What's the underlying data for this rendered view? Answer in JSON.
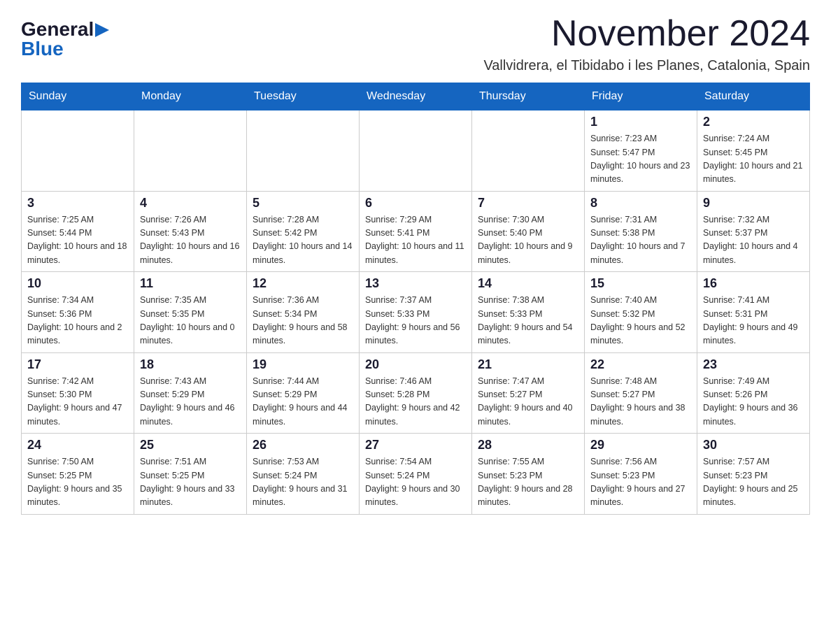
{
  "logo": {
    "general": "General",
    "blue": "Blue"
  },
  "title": "November 2024",
  "location": "Vallvidrera, el Tibidabo i les Planes, Catalonia, Spain",
  "days_of_week": [
    "Sunday",
    "Monday",
    "Tuesday",
    "Wednesday",
    "Thursday",
    "Friday",
    "Saturday"
  ],
  "weeks": [
    [
      {
        "day": "",
        "info": ""
      },
      {
        "day": "",
        "info": ""
      },
      {
        "day": "",
        "info": ""
      },
      {
        "day": "",
        "info": ""
      },
      {
        "day": "",
        "info": ""
      },
      {
        "day": "1",
        "info": "Sunrise: 7:23 AM\nSunset: 5:47 PM\nDaylight: 10 hours and 23 minutes."
      },
      {
        "day": "2",
        "info": "Sunrise: 7:24 AM\nSunset: 5:45 PM\nDaylight: 10 hours and 21 minutes."
      }
    ],
    [
      {
        "day": "3",
        "info": "Sunrise: 7:25 AM\nSunset: 5:44 PM\nDaylight: 10 hours and 18 minutes."
      },
      {
        "day": "4",
        "info": "Sunrise: 7:26 AM\nSunset: 5:43 PM\nDaylight: 10 hours and 16 minutes."
      },
      {
        "day": "5",
        "info": "Sunrise: 7:28 AM\nSunset: 5:42 PM\nDaylight: 10 hours and 14 minutes."
      },
      {
        "day": "6",
        "info": "Sunrise: 7:29 AM\nSunset: 5:41 PM\nDaylight: 10 hours and 11 minutes."
      },
      {
        "day": "7",
        "info": "Sunrise: 7:30 AM\nSunset: 5:40 PM\nDaylight: 10 hours and 9 minutes."
      },
      {
        "day": "8",
        "info": "Sunrise: 7:31 AM\nSunset: 5:38 PM\nDaylight: 10 hours and 7 minutes."
      },
      {
        "day": "9",
        "info": "Sunrise: 7:32 AM\nSunset: 5:37 PM\nDaylight: 10 hours and 4 minutes."
      }
    ],
    [
      {
        "day": "10",
        "info": "Sunrise: 7:34 AM\nSunset: 5:36 PM\nDaylight: 10 hours and 2 minutes."
      },
      {
        "day": "11",
        "info": "Sunrise: 7:35 AM\nSunset: 5:35 PM\nDaylight: 10 hours and 0 minutes."
      },
      {
        "day": "12",
        "info": "Sunrise: 7:36 AM\nSunset: 5:34 PM\nDaylight: 9 hours and 58 minutes."
      },
      {
        "day": "13",
        "info": "Sunrise: 7:37 AM\nSunset: 5:33 PM\nDaylight: 9 hours and 56 minutes."
      },
      {
        "day": "14",
        "info": "Sunrise: 7:38 AM\nSunset: 5:33 PM\nDaylight: 9 hours and 54 minutes."
      },
      {
        "day": "15",
        "info": "Sunrise: 7:40 AM\nSunset: 5:32 PM\nDaylight: 9 hours and 52 minutes."
      },
      {
        "day": "16",
        "info": "Sunrise: 7:41 AM\nSunset: 5:31 PM\nDaylight: 9 hours and 49 minutes."
      }
    ],
    [
      {
        "day": "17",
        "info": "Sunrise: 7:42 AM\nSunset: 5:30 PM\nDaylight: 9 hours and 47 minutes."
      },
      {
        "day": "18",
        "info": "Sunrise: 7:43 AM\nSunset: 5:29 PM\nDaylight: 9 hours and 46 minutes."
      },
      {
        "day": "19",
        "info": "Sunrise: 7:44 AM\nSunset: 5:29 PM\nDaylight: 9 hours and 44 minutes."
      },
      {
        "day": "20",
        "info": "Sunrise: 7:46 AM\nSunset: 5:28 PM\nDaylight: 9 hours and 42 minutes."
      },
      {
        "day": "21",
        "info": "Sunrise: 7:47 AM\nSunset: 5:27 PM\nDaylight: 9 hours and 40 minutes."
      },
      {
        "day": "22",
        "info": "Sunrise: 7:48 AM\nSunset: 5:27 PM\nDaylight: 9 hours and 38 minutes."
      },
      {
        "day": "23",
        "info": "Sunrise: 7:49 AM\nSunset: 5:26 PM\nDaylight: 9 hours and 36 minutes."
      }
    ],
    [
      {
        "day": "24",
        "info": "Sunrise: 7:50 AM\nSunset: 5:25 PM\nDaylight: 9 hours and 35 minutes."
      },
      {
        "day": "25",
        "info": "Sunrise: 7:51 AM\nSunset: 5:25 PM\nDaylight: 9 hours and 33 minutes."
      },
      {
        "day": "26",
        "info": "Sunrise: 7:53 AM\nSunset: 5:24 PM\nDaylight: 9 hours and 31 minutes."
      },
      {
        "day": "27",
        "info": "Sunrise: 7:54 AM\nSunset: 5:24 PM\nDaylight: 9 hours and 30 minutes."
      },
      {
        "day": "28",
        "info": "Sunrise: 7:55 AM\nSunset: 5:23 PM\nDaylight: 9 hours and 28 minutes."
      },
      {
        "day": "29",
        "info": "Sunrise: 7:56 AM\nSunset: 5:23 PM\nDaylight: 9 hours and 27 minutes."
      },
      {
        "day": "30",
        "info": "Sunrise: 7:57 AM\nSunset: 5:23 PM\nDaylight: 9 hours and 25 minutes."
      }
    ]
  ]
}
